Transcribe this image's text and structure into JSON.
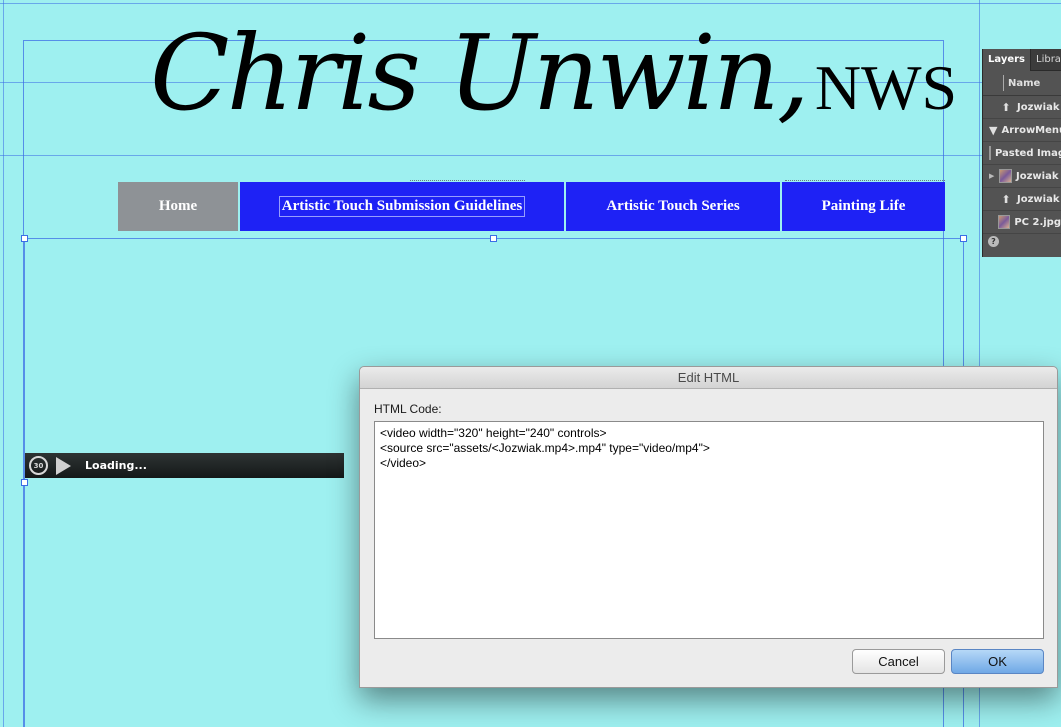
{
  "page": {
    "background_color": "#9ef0f0"
  },
  "logo": {
    "script_text": "Chris Unwin,",
    "suffix_text": "NWS"
  },
  "nav": {
    "items": [
      {
        "label": "Home",
        "state": "active",
        "color": "#8e9296"
      },
      {
        "label": "Artistic Touch Submission Guidelines",
        "state": "normal",
        "color": "#1e22f5"
      },
      {
        "label": "Artistic Touch Series",
        "state": "normal",
        "color": "#1e22f5"
      },
      {
        "label": "Painting Life",
        "state": "normal",
        "color": "#1e22f5"
      }
    ]
  },
  "video": {
    "rewind_icon": "rewind-30-icon",
    "rewind_text": "30",
    "play_icon": "play-icon",
    "status_text": "Loading..."
  },
  "layers_panel": {
    "tabs": [
      "Layers",
      "Library"
    ],
    "column_header": "Name",
    "rows": [
      {
        "icon": "arrow-up-icon",
        "label": "Jozwiak"
      },
      {
        "icon": "triangle-down-icon",
        "label": "ArrowMenu"
      },
      {
        "icon": "image-thumb-icon",
        "label": "Pasted Image"
      },
      {
        "icon": "image-thumb-icon",
        "label": "Jozwiak",
        "expandable": true
      },
      {
        "icon": "arrow-up-icon",
        "label": "Jozwiak"
      },
      {
        "icon": "image-thumb-icon",
        "label": "PC 2.jpg"
      }
    ],
    "help_icon": "help-icon"
  },
  "dialog": {
    "title": "Edit HTML",
    "code_label": "HTML Code:",
    "code_value": "<video width=\"320\" height=\"240\" controls>\n<source src=\"assets/<Jozwiak.mp4>.mp4\" type=\"video/mp4\">\n</video>",
    "cancel_label": "Cancel",
    "ok_label": "OK"
  }
}
